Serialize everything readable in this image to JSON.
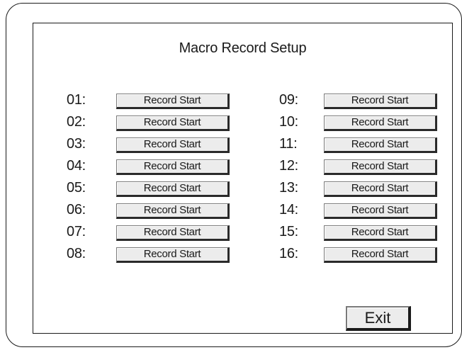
{
  "dialog": {
    "title": "Macro Record Setup"
  },
  "left_column": [
    {
      "label": "01:",
      "button": "Record Start"
    },
    {
      "label": "02:",
      "button": "Record Start"
    },
    {
      "label": "03:",
      "button": "Record Start"
    },
    {
      "label": "04:",
      "button": "Record Start"
    },
    {
      "label": "05:",
      "button": "Record Start"
    },
    {
      "label": "06:",
      "button": "Record Start"
    },
    {
      "label": "07:",
      "button": "Record Start"
    },
    {
      "label": "08:",
      "button": "Record Start"
    }
  ],
  "right_column": [
    {
      "label": "09:",
      "button": "Record Start"
    },
    {
      "label": "10:",
      "button": "Record Start"
    },
    {
      "label": "11:",
      "button": "Record Start"
    },
    {
      "label": "12:",
      "button": "Record Start"
    },
    {
      "label": "13:",
      "button": "Record Start"
    },
    {
      "label": "14:",
      "button": "Record Start"
    },
    {
      "label": "15:",
      "button": "Record Start"
    },
    {
      "label": "16:",
      "button": "Record Start"
    }
  ],
  "footer": {
    "exit_label": "Exit"
  }
}
